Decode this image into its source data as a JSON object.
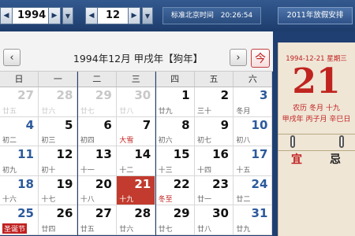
{
  "toolbar": {
    "year": "1994",
    "month": "12",
    "clock_label": "标准北京时间",
    "clock_time": "20:26:54",
    "holiday_button": "2011年放假安排"
  },
  "calendar": {
    "title": "1994年12月  甲戌年【狗年】",
    "today_label": "今",
    "weekdays": [
      "日",
      "一",
      "二",
      "三",
      "四",
      "五",
      "六"
    ],
    "rows": [
      [
        [
          "27",
          "廿五",
          "o"
        ],
        [
          "28",
          "廿六",
          "o"
        ],
        [
          "29",
          "廿七",
          "o"
        ],
        [
          "30",
          "廿八",
          "o"
        ],
        [
          "1",
          "廿九",
          ""
        ],
        [
          "2",
          "三十",
          ""
        ],
        [
          "3",
          "冬月",
          "w"
        ]
      ],
      [
        [
          "4",
          "初二",
          "w"
        ],
        [
          "5",
          "初三",
          ""
        ],
        [
          "6",
          "初四",
          ""
        ],
        [
          "7",
          "大雪",
          "r"
        ],
        [
          "8",
          "初六",
          ""
        ],
        [
          "9",
          "初七",
          ""
        ],
        [
          "10",
          "初八",
          "w"
        ]
      ],
      [
        [
          "11",
          "初九",
          "w"
        ],
        [
          "12",
          "初十",
          ""
        ],
        [
          "13",
          "十一",
          ""
        ],
        [
          "14",
          "十二",
          ""
        ],
        [
          "15",
          "十三",
          ""
        ],
        [
          "16",
          "十四",
          ""
        ],
        [
          "17",
          "十五",
          "w"
        ]
      ],
      [
        [
          "18",
          "十六",
          "w"
        ],
        [
          "19",
          "十七",
          ""
        ],
        [
          "20",
          "十八",
          ""
        ],
        [
          "21",
          "十九",
          "s"
        ],
        [
          "22",
          "冬至",
          "r"
        ],
        [
          "23",
          "廿一",
          ""
        ],
        [
          "24",
          "廿二",
          "w"
        ]
      ],
      [
        [
          "25",
          "圣诞节",
          "wb"
        ],
        [
          "26",
          "廿四",
          ""
        ],
        [
          "27",
          "廿五",
          ""
        ],
        [
          "28",
          "廿六",
          ""
        ],
        [
          "29",
          "廿七",
          ""
        ],
        [
          "30",
          "廿八",
          ""
        ],
        [
          "31",
          "廿九",
          "w"
        ]
      ]
    ]
  },
  "side": {
    "date_line": "1994-12-21 星期三",
    "day": "21",
    "lunar": "农历 冬月 十九",
    "ganzhi": "甲戌年 丙子月 辛巳日",
    "yi": "宜",
    "ji": "忌"
  }
}
